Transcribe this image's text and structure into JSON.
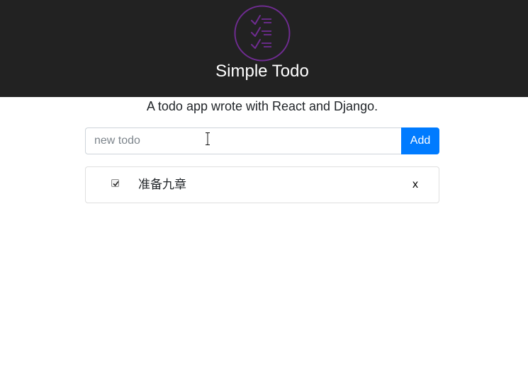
{
  "header": {
    "title": "Simple Todo",
    "logo_icon": "checklist-icon",
    "logo_color": "#6f2c91",
    "background": "#222222"
  },
  "tagline": "A todo app wrote with React and Django.",
  "new_todo": {
    "value": "",
    "placeholder": "new todo",
    "add_label": "Add",
    "accent": "#007bff"
  },
  "todos": [
    {
      "text": "准备九章",
      "checked": true,
      "delete_label": "x"
    }
  ]
}
